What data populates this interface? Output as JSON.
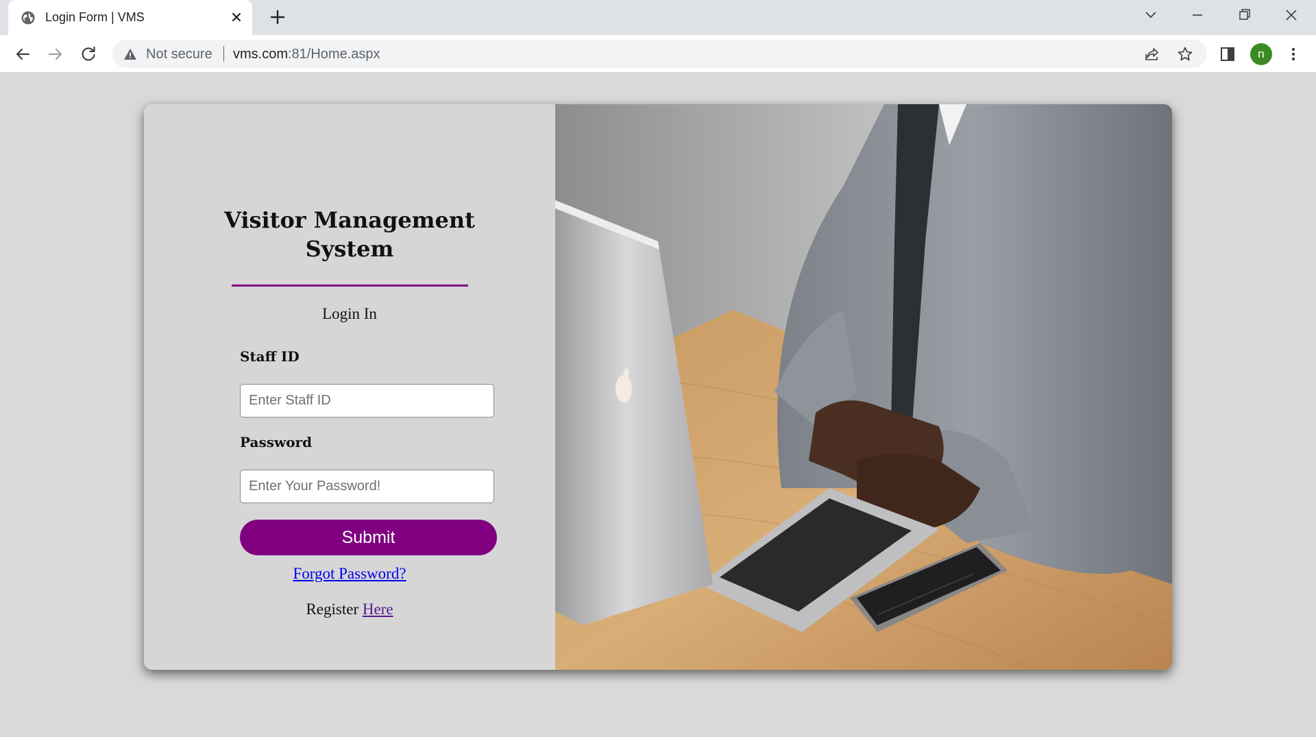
{
  "browser": {
    "tab_title": "Login Form | VMS",
    "security_label": "Not secure",
    "url_host": "vms.com",
    "url_rest": ":81/Home.aspx",
    "profile_initial": "n"
  },
  "login": {
    "heading": "Visitor Management System",
    "subheading": "Login In",
    "staff_id_label": "Staff ID",
    "staff_id_placeholder": "Enter Staff ID",
    "password_label": "Password",
    "password_placeholder": "Enter Your Password!",
    "submit_label": "Submit",
    "forgot_label": "Forgot Password?",
    "register_prefix": "Register ",
    "register_link": "Here"
  },
  "colors": {
    "accent": "#800080",
    "page_background": "#d9d9d9",
    "panel_background": "#d6d6d6",
    "link": "#0000ee",
    "visited_link": "#551a8b"
  }
}
